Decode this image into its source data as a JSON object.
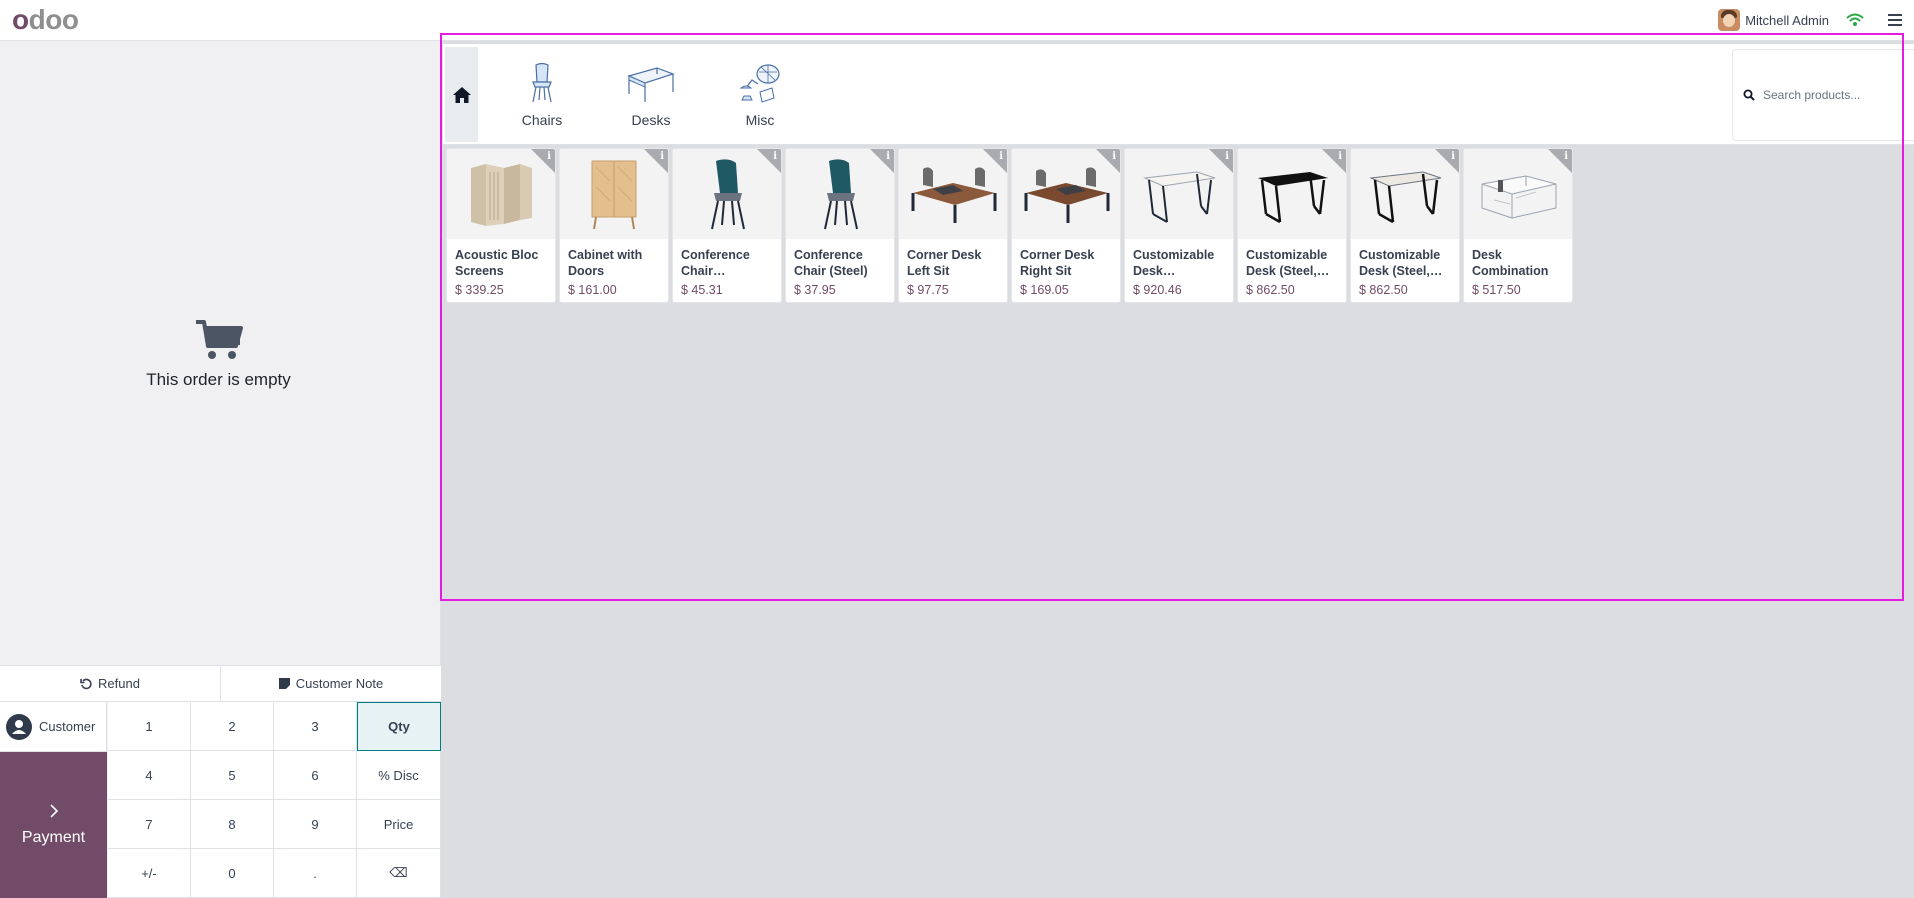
{
  "topbar": {
    "logo_first": "o",
    "logo_rest": "doo",
    "user_name": "Mitchell Admin",
    "icons": [
      "avatar",
      "wifi-icon",
      "hamburger-menu-icon"
    ],
    "wifi_color": "#28a745"
  },
  "order": {
    "empty_message": "This order is empty"
  },
  "actions": {
    "refund": "Refund",
    "customer_note": "Customer Note"
  },
  "numpad": {
    "customer": "Customer",
    "payment": "Payment",
    "keys": [
      "1",
      "2",
      "3",
      "Qty",
      "4",
      "5",
      "6",
      "% Disc",
      "7",
      "8",
      "9",
      "Price",
      "+/-",
      "0",
      ".",
      "⌫"
    ],
    "active_key": "Qty"
  },
  "categories": [
    {
      "label": "Chairs",
      "icon": "chair-icon"
    },
    {
      "label": "Desks",
      "icon": "desk-icon"
    },
    {
      "label": "Misc",
      "icon": "misc-icon"
    }
  ],
  "search": {
    "placeholder": "Search products..."
  },
  "products": [
    {
      "name": "Acoustic Bloc Screens",
      "price": "$ 339.25",
      "image": "screen"
    },
    {
      "name": "Cabinet with Doors",
      "price": "$ 161.00",
      "image": "cabinet"
    },
    {
      "name": "Conference Chair…",
      "price": "$ 45.31",
      "image": "chair"
    },
    {
      "name": "Conference Chair (Steel)",
      "price": "$ 37.95",
      "image": "chair"
    },
    {
      "name": "Corner Desk Left Sit",
      "price": "$ 97.75",
      "image": "corner-desk"
    },
    {
      "name": "Corner Desk Right Sit",
      "price": "$ 169.05",
      "image": "corner-desk"
    },
    {
      "name": "Customizable Desk…",
      "price": "$ 920.46",
      "image": "desk-white"
    },
    {
      "name": "Customizable Desk (Steel,…",
      "price": "$ 862.50",
      "image": "desk-black"
    },
    {
      "name": "Customizable Desk (Steel,…",
      "price": "$ 862.50",
      "image": "desk-white"
    },
    {
      "name": "Desk Combination",
      "price": "$ 517.50",
      "image": "desk-combo"
    }
  ],
  "colors": {
    "brand": "#714b67",
    "active_key_border": "#017e84",
    "highlight": "#e41ce1"
  }
}
